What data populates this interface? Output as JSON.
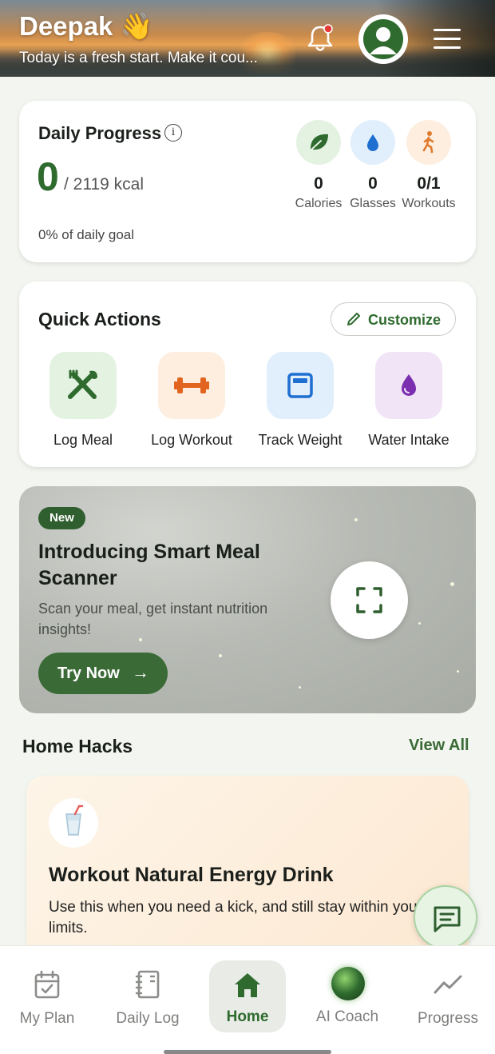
{
  "header": {
    "user_name": "Deepak 👋",
    "greeting": "Today is a fresh start. Make it cou..."
  },
  "daily_progress": {
    "title": "Daily Progress",
    "calories_consumed": "0",
    "calorie_goal": "/ 2119 kcal",
    "goal_percent": "0% of daily goal",
    "stats": [
      {
        "value": "0",
        "label": "Calories",
        "icon": "leaf-icon",
        "color": "#2f6b2f"
      },
      {
        "value": "0",
        "label": "Glasses",
        "icon": "water-drop-icon",
        "color": "#1f6fd1"
      },
      {
        "value": "0/1",
        "label": "Workouts",
        "icon": "running-icon",
        "color": "#e07a2c"
      }
    ]
  },
  "quick_actions": {
    "title": "Quick Actions",
    "customize_label": "Customize",
    "items": [
      {
        "label": "Log Meal",
        "icon": "utensils-icon"
      },
      {
        "label": "Log Workout",
        "icon": "dumbbell-icon"
      },
      {
        "label": "Track Weight",
        "icon": "scale-icon"
      },
      {
        "label": "Water Intake",
        "icon": "water-drop-icon"
      }
    ]
  },
  "promo": {
    "badge": "New",
    "title": "Introducing Smart Meal Scanner",
    "subtitle": "Scan your meal, get instant nutrition insights!",
    "cta_label": "Try Now",
    "cta_arrow": "→"
  },
  "home_hacks": {
    "title": "Home Hacks",
    "view_all_label": "View All",
    "card": {
      "title": "Workout Natural Energy Drink",
      "description": "Use this when you need a kick, and still stay within your limits."
    }
  },
  "bottom_nav": {
    "items": [
      {
        "label": "My Plan",
        "icon": "calendar-check-icon",
        "active": false
      },
      {
        "label": "Daily Log",
        "icon": "notebook-icon",
        "active": false
      },
      {
        "label": "Home",
        "icon": "home-icon",
        "active": true
      },
      {
        "label": "AI Coach",
        "icon": "ai-coach-orb-icon",
        "active": false
      },
      {
        "label": "Progress",
        "icon": "trend-line-icon",
        "active": false
      }
    ]
  },
  "colors": {
    "brand_green": "#2f6b2f",
    "accent_orange": "#e07a2c",
    "accent_blue": "#1f6fd1",
    "accent_purple": "#7b2fb0"
  }
}
